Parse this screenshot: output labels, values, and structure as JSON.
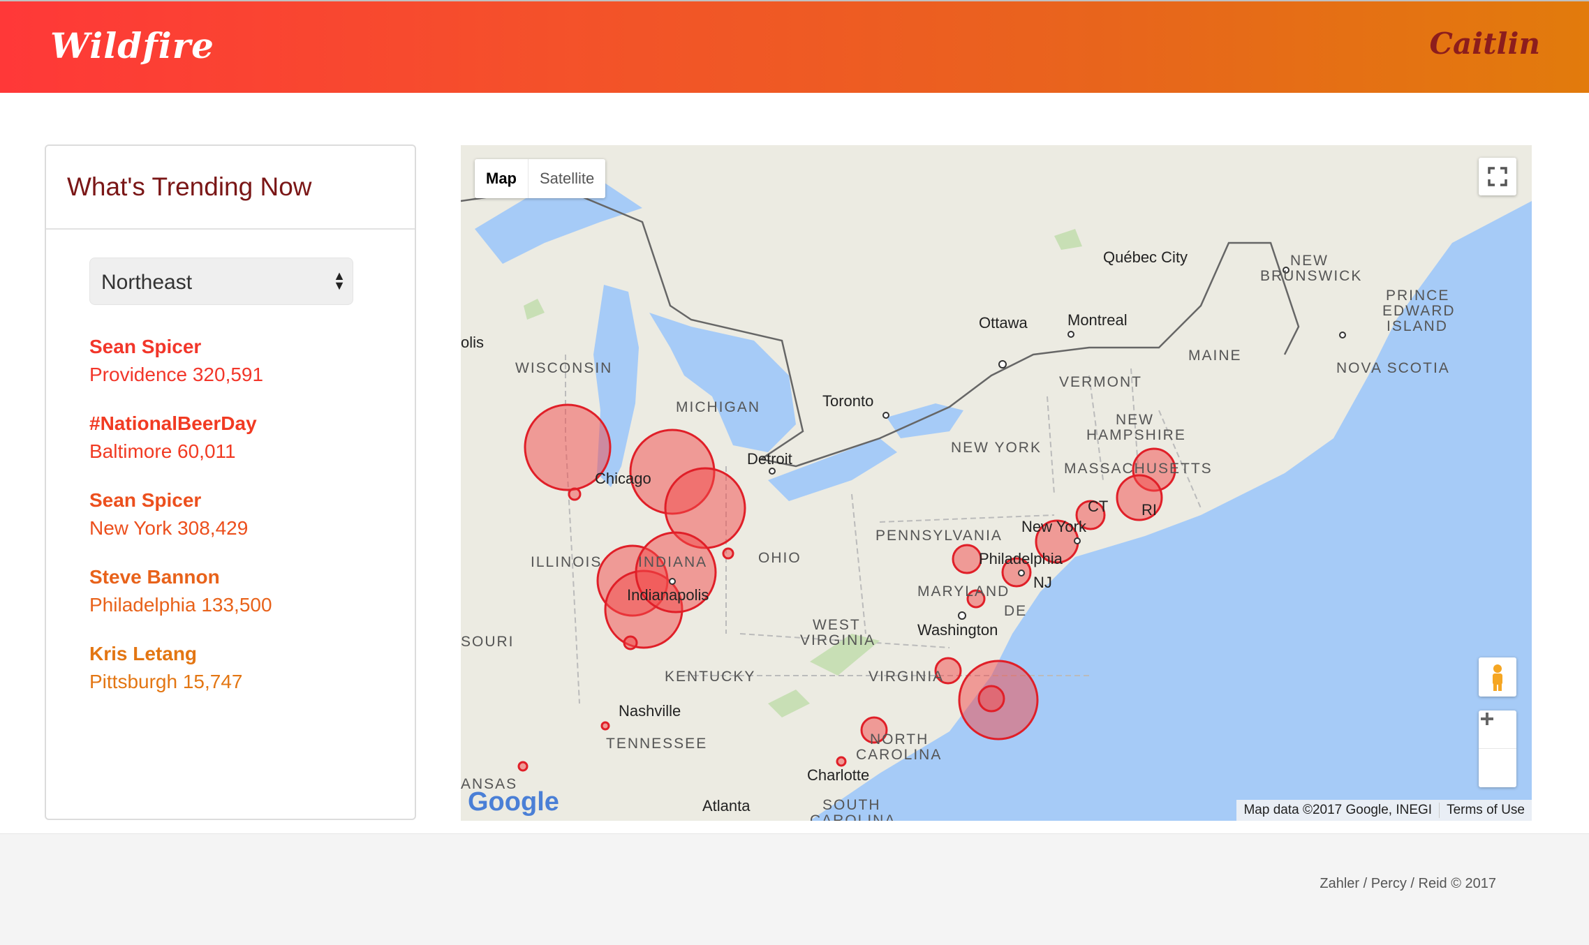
{
  "header": {
    "brand": "Wildfire",
    "user": "Caitlin"
  },
  "sidebar": {
    "title": "What's Trending Now",
    "region_select": {
      "value": "Northeast"
    },
    "trends": [
      {
        "name": "Sean Spicer",
        "location": "Providence 320,591",
        "color": "#f2362a"
      },
      {
        "name": "#NationalBeerDay",
        "location": "Baltimore 60,011",
        "color": "#f13a22"
      },
      {
        "name": "Sean Spicer",
        "location": "New York 308,429",
        "color": "#ec4f1d"
      },
      {
        "name": "Steve Bannon",
        "location": "Philadelphia 133,500",
        "color": "#e8621a"
      },
      {
        "name": "Kris Letang",
        "location": "Pittsburgh 15,747",
        "color": "#e37613"
      }
    ]
  },
  "map": {
    "type_controls": {
      "map": "Map",
      "satellite": "Satellite"
    },
    "labels": {
      "quebec_city": "Québec City",
      "new_brunswick_1": "NEW",
      "new_brunswick_2": "BRUNSWICK",
      "pei_1": "PRINCE",
      "pei_2": "EDWARD",
      "pei_3": "ISLAND",
      "ottawa": "Ottawa",
      "montreal": "Montreal",
      "maine": "MAINE",
      "nova_scotia": "NOVA SCOTIA",
      "polis": "olis",
      "wisconsin": "WISCONSIN",
      "vermont": "VERMONT",
      "toronto": "Toronto",
      "michigan": "MICHIGAN",
      "new_hampshire_1": "NEW",
      "new_hampshire_2": "HAMPSHIRE",
      "new_york_state": "NEW YORK",
      "massachusetts": "MASSACHUSETTS",
      "detroit": "Detroit",
      "chicago": "Chicago",
      "ct": "CT",
      "ri": "RI",
      "pennsylvania": "PENNSYLVANIA",
      "new_york_city": "New York",
      "illinois": "ILLINOIS",
      "indiana": "INDIANA",
      "ohio": "OHIO",
      "philadelphia": "Philadelphia",
      "nj": "NJ",
      "indianapolis": "Indianapolis",
      "maryland": "MARYLAND",
      "de": "DE",
      "west_virginia_1": "WEST",
      "west_virginia_2": "VIRGINIA",
      "washington": "Washington",
      "missouri": "SOURI",
      "kentucky": "KENTUCKY",
      "virginia": "VIRGINIA",
      "nashville": "Nashville",
      "north_carolina_1": "NORTH",
      "north_carolina_2": "CAROLINA",
      "tennessee": "TENNESSEE",
      "charlotte": "Charlotte",
      "arkansas": "ANSAS",
      "atlanta": "Atlanta",
      "south_carolina_1": "SOUTH",
      "south_carolina_2": "CAROLINA"
    },
    "logo": "Google",
    "attribution": "Map data ©2017 Google, INEGI",
    "terms": "Terms of Use",
    "circle_color": "#f24a4a",
    "circle_stroke": "#e01f28"
  },
  "footer": {
    "credits": "Zahler / Percy / Reid © 2017"
  }
}
